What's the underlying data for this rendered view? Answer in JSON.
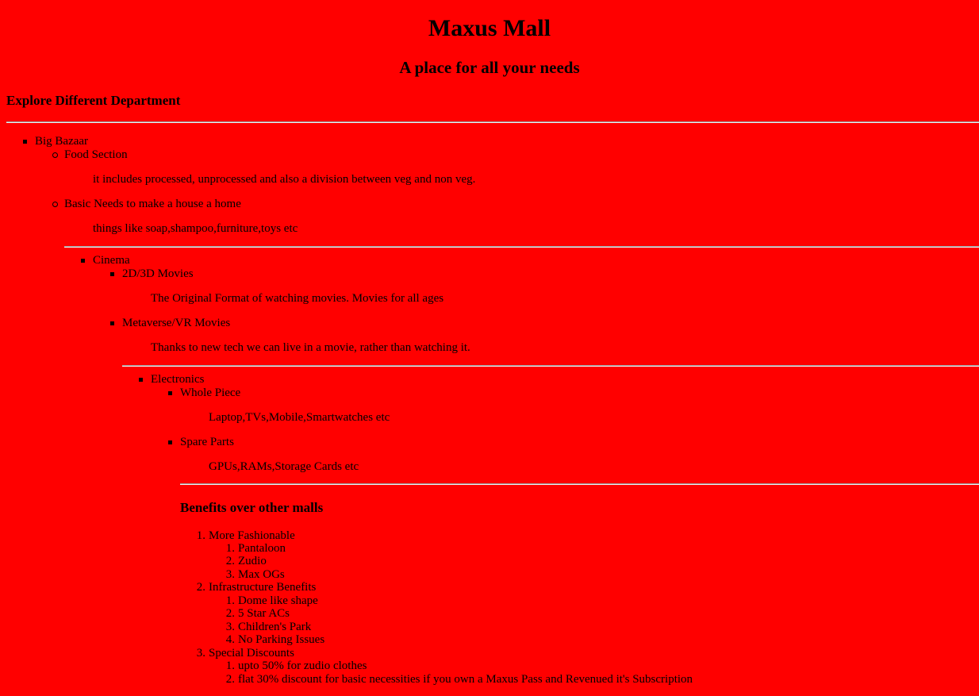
{
  "header": {
    "title": "Maxus Mall",
    "subtitle": "A place for all your needs"
  },
  "explore": {
    "heading": "Explore Different Department"
  },
  "big_bazaar": {
    "label": "Big Bazaar",
    "food": {
      "label": "Food Section",
      "desc": "it includes processed, unprocessed and also a division between veg and non veg."
    },
    "basic": {
      "label": "Basic Needs to make a house a home",
      "desc": "things like soap,shampoo,furniture,toys etc"
    }
  },
  "cinema": {
    "label": "Cinema",
    "movies2d3d": {
      "label": "2D/3D Movies",
      "desc": "The Original Format of watching movies. Movies for all ages"
    },
    "metaverse": {
      "label": "Metaverse/VR Movies",
      "desc": "Thanks to new tech we can live in a movie, rather than watching it."
    }
  },
  "electronics": {
    "label": "Electronics",
    "whole": {
      "label": "Whole Piece",
      "desc": "Laptop,TVs,Mobile,Smartwatches etc"
    },
    "spare": {
      "label": "Spare Parts",
      "desc": "GPUs,RAMs,Storage Cards etc"
    }
  },
  "benefits": {
    "heading": "Benefits over other malls",
    "items": [
      {
        "num": "1.",
        "label": "More Fashionable",
        "sub": [
          {
            "num": "1.",
            "label": "Pantaloon"
          },
          {
            "num": "2.",
            "label": "Zudio"
          },
          {
            "num": "3.",
            "label": "Max OGs"
          }
        ]
      },
      {
        "num": "2.",
        "label": "Infrastructure Benefits",
        "sub": [
          {
            "num": "1.",
            "label": "Dome like shape"
          },
          {
            "num": "2.",
            "label": "5 Star ACs"
          },
          {
            "num": "3.",
            "label": "Children's Park"
          },
          {
            "num": "4.",
            "label": "No Parking Issues"
          }
        ]
      },
      {
        "num": "3.",
        "label": "Special Discounts",
        "sub": [
          {
            "num": "1.",
            "label": "upto 50% for zudio clothes"
          },
          {
            "num": "2.",
            "label": "flat 30% discount for basic necessities if you own a Maxus Pass and Revenued it's Subscription"
          }
        ]
      }
    ]
  },
  "colors": {
    "background": "#ff0000",
    "text": "#000000"
  }
}
